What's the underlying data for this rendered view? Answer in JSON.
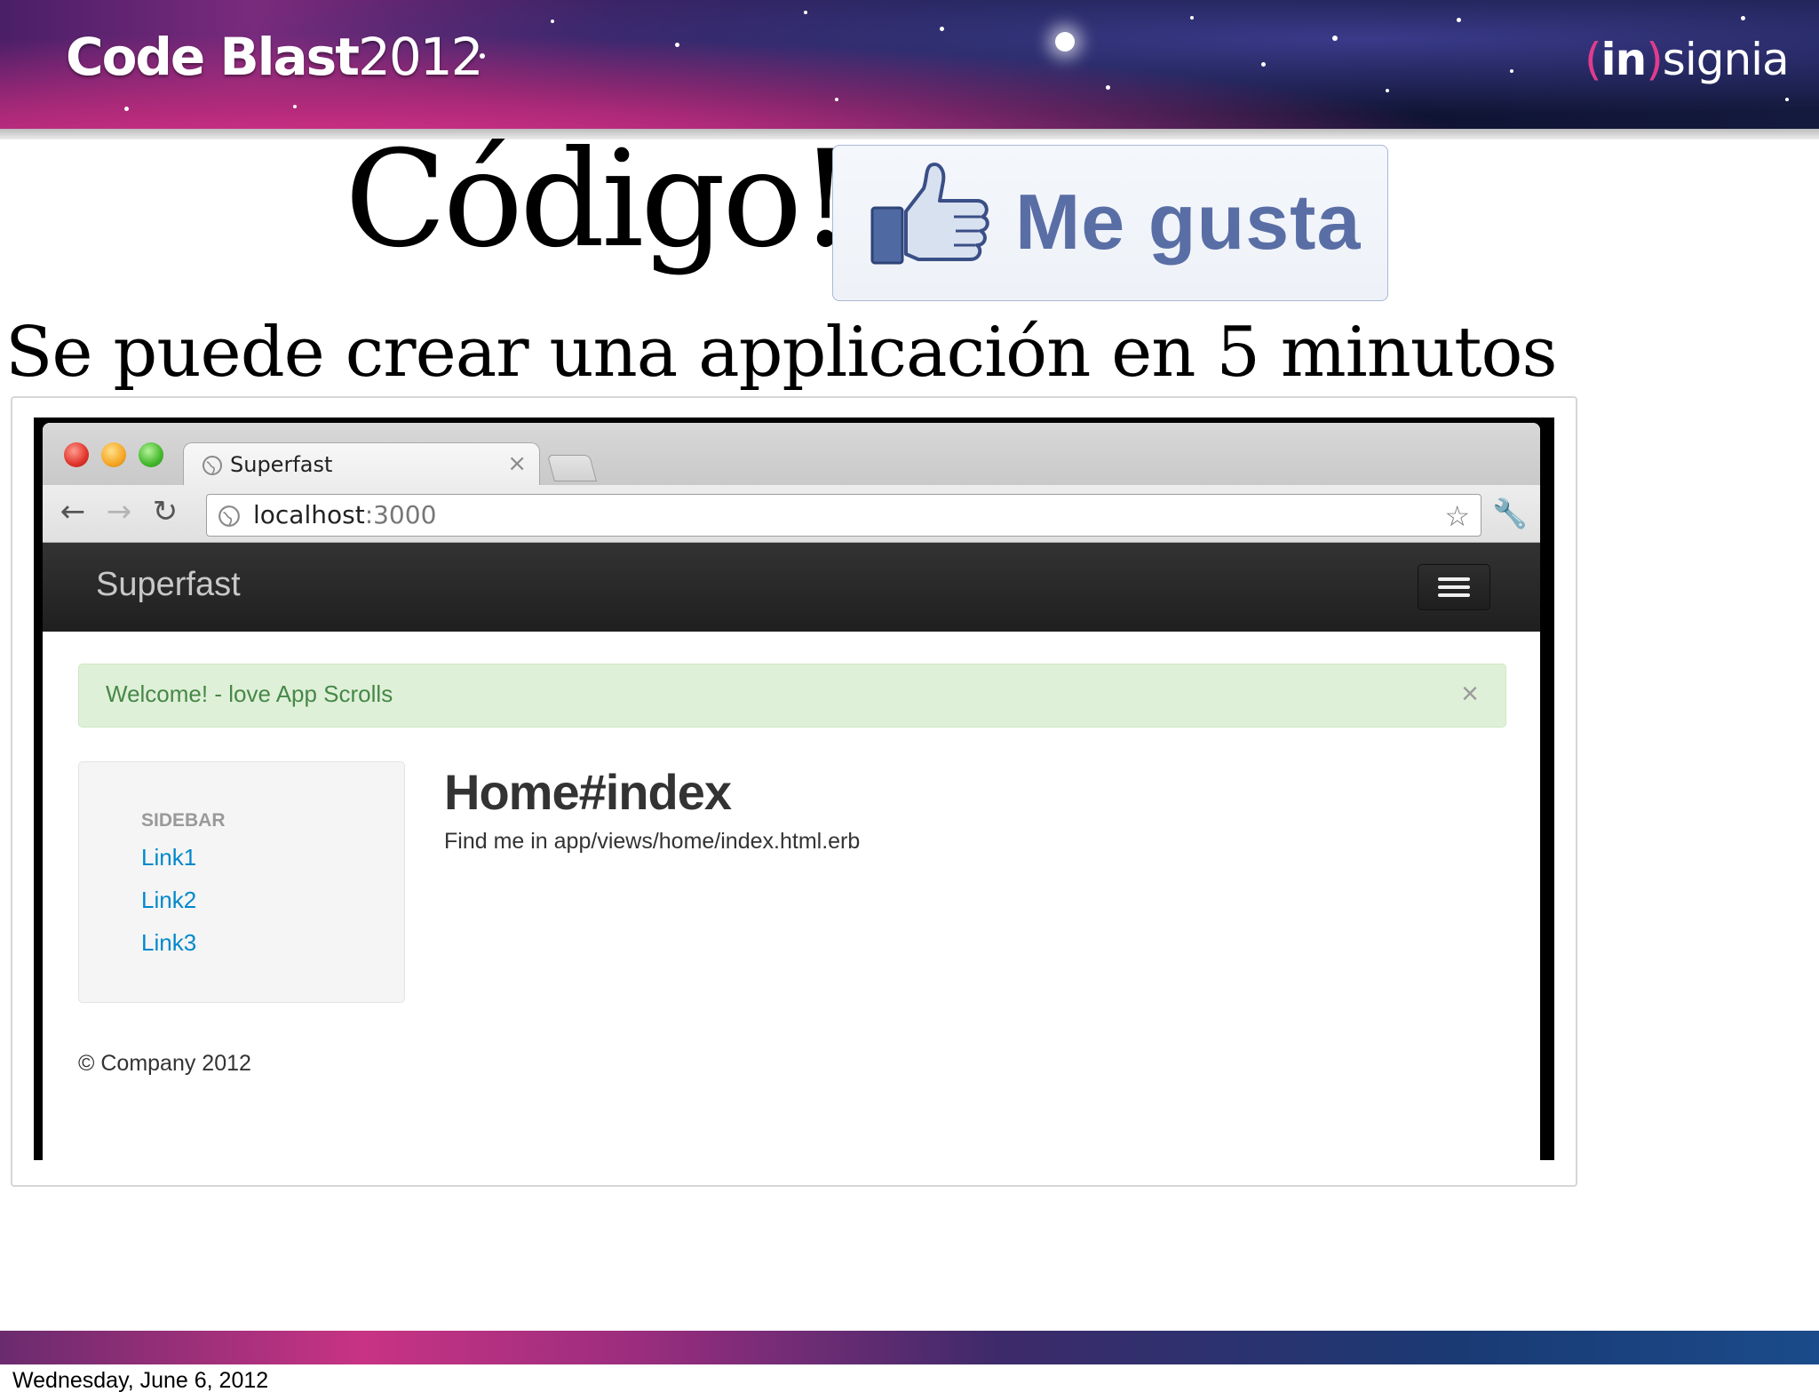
{
  "banner": {
    "event_name": "Code Blast",
    "event_year": "2012",
    "logo_paren_open": "(",
    "logo_in": "in",
    "logo_paren_close": ")",
    "logo_rest": "signia"
  },
  "slide": {
    "heading": "Código!",
    "like_label": "Me gusta",
    "subtitle": "Se puede crear una applicación en 5 minutos"
  },
  "browser": {
    "tab_title": "Superfast",
    "tab_close": "×",
    "url_host": "localhost",
    "url_port": ":3000",
    "nav_back": "←",
    "nav_forward": "→",
    "nav_reload": "↻",
    "bookmark_star": "☆",
    "wrench": "🔧"
  },
  "app": {
    "brand": "Superfast",
    "alert_text": "Welcome! - love App Scrolls",
    "alert_close": "×",
    "sidebar_header": "SIDEBAR",
    "sidebar_links": [
      "Link1",
      "Link2",
      "Link3"
    ],
    "main_title": "Home#index",
    "main_subtitle": "Find me in app/views/home/index.html.erb",
    "footer": "© Company 2012"
  },
  "footer": {
    "date": "Wednesday, June 6, 2012"
  },
  "colors": {
    "like_text": "#5a6ea6",
    "alert_bg": "#dff0d8",
    "alert_text": "#468847",
    "link": "#0088cc",
    "navbar": "#222222"
  }
}
